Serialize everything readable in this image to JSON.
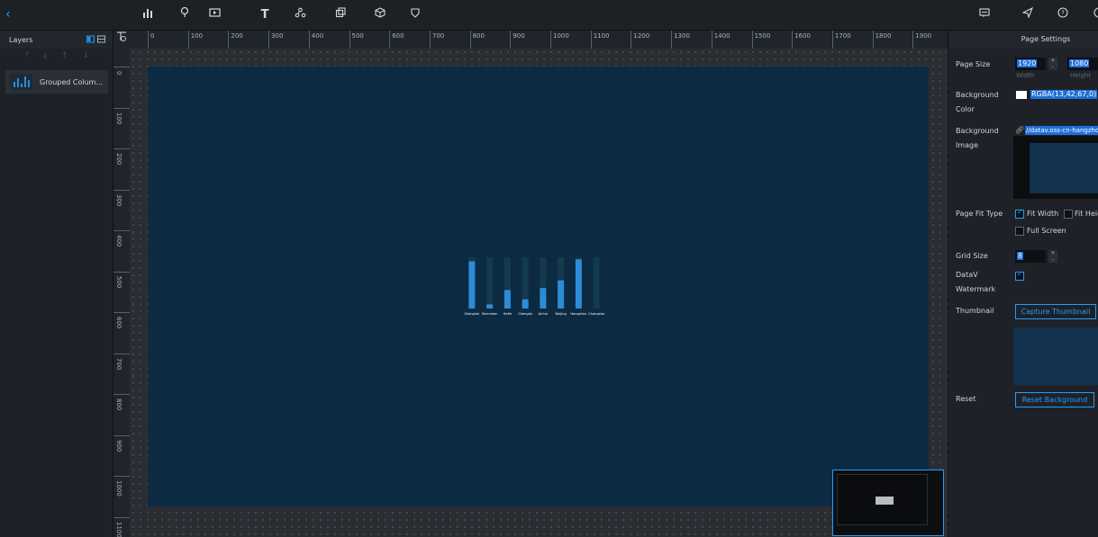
{
  "toolbar": {
    "back_icon": "chevron-left-icon",
    "tools": [
      "bar-chart-icon",
      "map-pin-icon",
      "media-icon",
      "text-icon",
      "relation-icon",
      "component-icon",
      "box-icon",
      "favorite-icon"
    ],
    "text_tool_label": "T",
    "right_tools": [
      "comment-icon",
      "publish-icon",
      "help-icon"
    ]
  },
  "layers": {
    "title": "Layers",
    "items": [
      {
        "label": "Grouped Colum..."
      }
    ]
  },
  "rulers": {
    "horizontal": [
      "0",
      "100",
      "200",
      "300",
      "400",
      "500",
      "600",
      "700",
      "800",
      "900",
      "1000",
      "1100",
      "1200",
      "1300",
      "1400",
      "1500",
      "1600",
      "1700",
      "1800",
      "1900"
    ],
    "vertical": [
      "0",
      "100",
      "200",
      "300",
      "400",
      "500",
      "600",
      "700",
      "800",
      "900",
      "1000",
      "1100"
    ]
  },
  "chart_data": {
    "type": "bar",
    "categories": [
      "Shanghai",
      "Shenzhen",
      "Hefei",
      "Chengdu",
      "Anhui",
      "Beijing",
      "Hangzhou",
      "Changsha"
    ],
    "series": [
      {
        "values": [
          92,
          8,
          36,
          18,
          40,
          55,
          96,
          0
        ]
      }
    ],
    "background_values": [
      100,
      100,
      100,
      100,
      100,
      100,
      100,
      100
    ],
    "bar_color": "#2d8cd6",
    "background_bar_color": "#143a4f",
    "ylim": [
      0,
      100
    ]
  },
  "settings": {
    "title": "Page Settings",
    "page_size_label": "Page Size",
    "width_value": "1920",
    "height_value": "1080",
    "width_sub": "Width",
    "height_sub": "Height",
    "bg_color_label": "Background Color",
    "bg_color_value": "RGBA(13,42,67,0)",
    "bg_image_label": "Background Image",
    "bg_image_url": "//datav.oss-cn-hangzho",
    "fit_type_label": "Page Fit Type",
    "fit_width": "Fit Width",
    "fit_height": "Fit Heig",
    "full_screen": "Full Screen",
    "grid_size_label": "Grid Size",
    "grid_size_value": "8",
    "watermark_label": "DataV Watermark",
    "thumbnail_label": "Thumbnail",
    "capture_button": "Capture Thumbnail",
    "reset_label": "Reset",
    "reset_button": "Reset Background"
  },
  "colors": {
    "accent": "#1e9fff",
    "canvas_bg": "#0d2a43"
  }
}
